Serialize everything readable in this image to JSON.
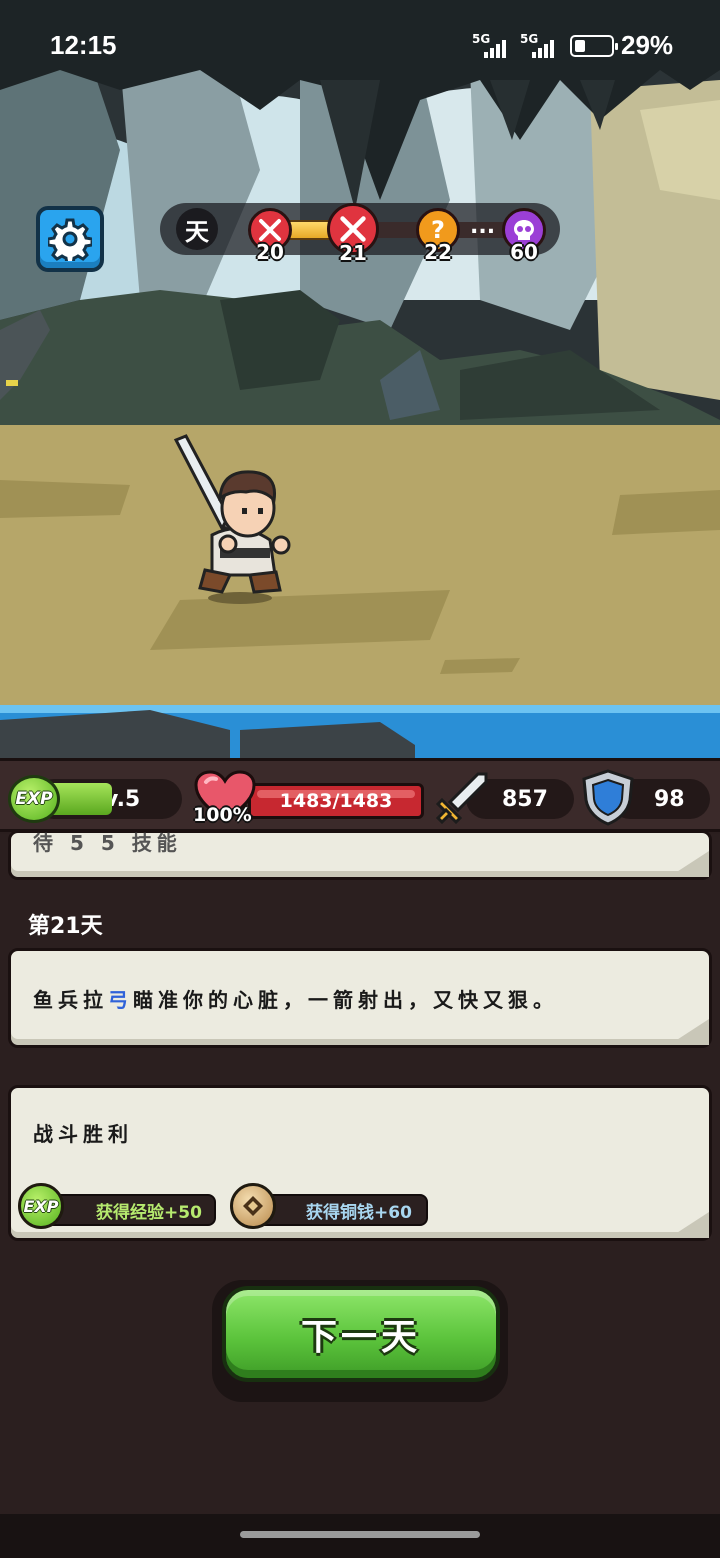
{
  "status_bar": {
    "time": "12:15",
    "network_1": "5G",
    "network_2": "5G",
    "battery_percent": "29%"
  },
  "top_hud": {
    "day_label": "天",
    "nodes": [
      {
        "day": "20",
        "type": "battle",
        "color": "#e0343f"
      },
      {
        "day": "21",
        "type": "battle",
        "color": "#e0343f"
      },
      {
        "day": "22",
        "type": "mystery",
        "color": "#f19a1c",
        "glyph": "?"
      },
      {
        "day": "60",
        "type": "boss-skull",
        "color": "#9b3fd6"
      }
    ],
    "ellipsis": "..."
  },
  "stats": {
    "exp_icon_label": "EXP",
    "level": "Lv.5",
    "hp_percent": "100%",
    "hp": "1483/1483",
    "attack": "857",
    "defense": "98"
  },
  "log": {
    "prev_card_partial": "待 5 5 技能",
    "day_heading": "第21天",
    "attack_text": {
      "before": "鱼兵拉",
      "highlight": "弓",
      "after": "瞄准你的心脏，一箭射出，又快又狠。"
    },
    "result_text": "战斗胜利",
    "rewards": [
      {
        "icon": "EXP",
        "label": "获得经验+50"
      },
      {
        "icon": "coin-icon",
        "label": "获得铜钱+60"
      }
    ]
  },
  "next_button_label": "下一天",
  "colors": {
    "hp_red": "#c72830",
    "exp_green": "#5aa71f",
    "button_green": "#5cc43c",
    "highlight_blue": "#2f62d9"
  }
}
